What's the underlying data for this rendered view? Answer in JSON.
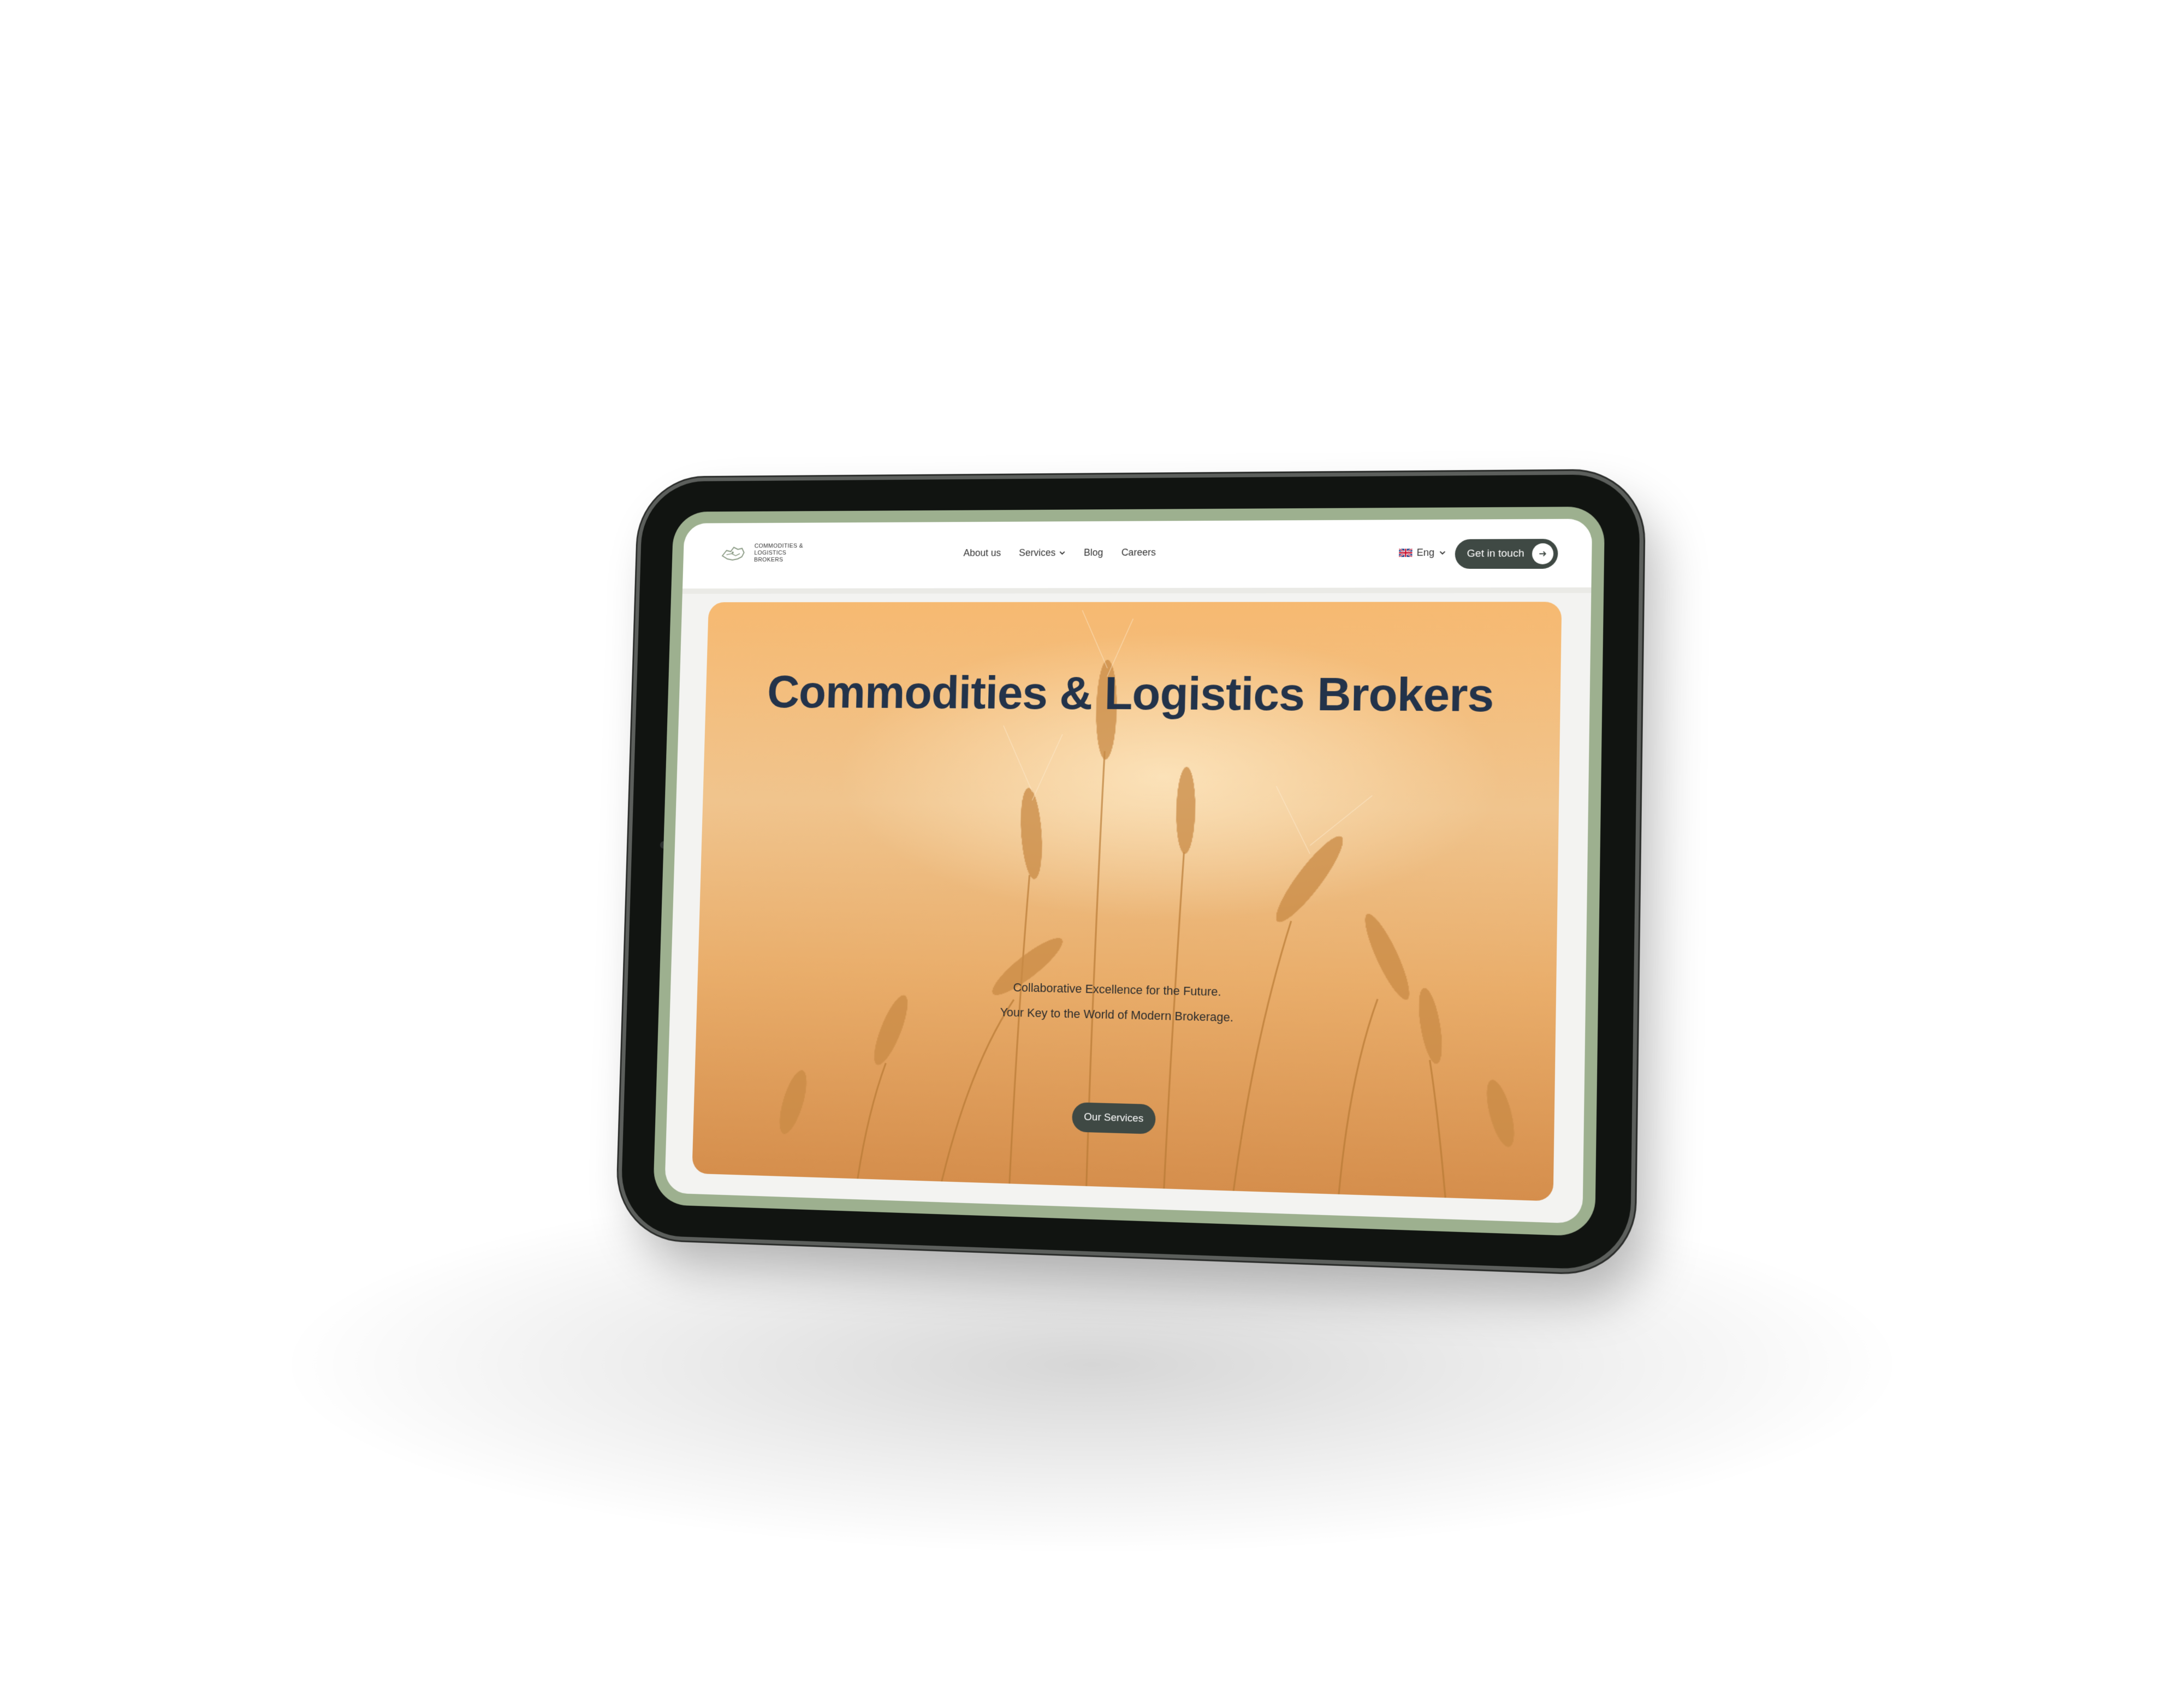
{
  "brand": {
    "logo_line1": "COMMODITIES &",
    "logo_line2": "LOGISTICS",
    "logo_line3": "BROKERS"
  },
  "nav": {
    "items": [
      {
        "label": "About us",
        "has_dropdown": false
      },
      {
        "label": "Services",
        "has_dropdown": true
      },
      {
        "label": "Blog",
        "has_dropdown": false
      },
      {
        "label": "Careers",
        "has_dropdown": false
      }
    ]
  },
  "language": {
    "selected": "Eng",
    "icon": "uk-flag-icon"
  },
  "header_cta": {
    "label": "Get in touch",
    "icon": "arrow-right-icon"
  },
  "hero": {
    "title": "Commodities & Logistics Brokers",
    "line1": "Collaborative Excellence for the Future.",
    "line2": "Your Key to the World of Modern Brokerage.",
    "button": "Our Services"
  },
  "colors": {
    "frame_green": "#9db08f",
    "button_dark": "#3f4944",
    "title_navy": "#23334a",
    "hero_gold": "#f0c48d"
  }
}
